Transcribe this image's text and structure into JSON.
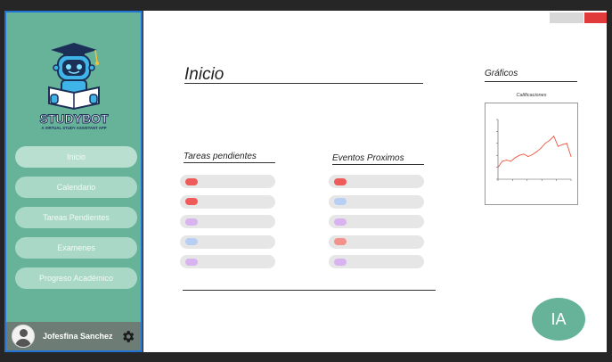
{
  "colors": {
    "sidebar": "#66b39a",
    "nav_button": "#a9d8c7",
    "accent_border": "#1f74d6",
    "red": "#ef5b5b",
    "purple": "#d9b3f0",
    "blue": "#b8cff5",
    "pink": "#f3928d"
  },
  "brand": {
    "name": "STUDYBOT",
    "tagline": "A VIRTUAL STUDY ASSISTANT APP",
    "logo_icon": "robot-graduation-cap-icon"
  },
  "sidebar": {
    "items": [
      {
        "label": "Inicio"
      },
      {
        "label": "Calendario"
      },
      {
        "label": "Tareas Pendientes"
      },
      {
        "label": "Examenes"
      },
      {
        "label": "Progreso Académico"
      }
    ]
  },
  "user": {
    "name": "Jofesfina Sanchez",
    "avatar_icon": "user-avatar-icon",
    "settings_icon": "gear-icon"
  },
  "main": {
    "title": "Inicio",
    "tasks": {
      "title": "Tareas pendientes",
      "items": [
        {
          "color": "#ef5b5b"
        },
        {
          "color": "#ef5b5b"
        },
        {
          "color": "#d9b3f0"
        },
        {
          "color": "#b8cff5"
        },
        {
          "color": "#d9b3f0"
        }
      ]
    },
    "events": {
      "title": "Eventos Proximos",
      "items": [
        {
          "color": "#ef5b5b"
        },
        {
          "color": "#b8cff5"
        },
        {
          "color": "#d9b3f0"
        },
        {
          "color": "#f3928d"
        },
        {
          "color": "#d9b3f0"
        }
      ]
    },
    "charts_title": "Gráficos",
    "ia_button": "IA"
  },
  "chart_data": {
    "type": "line",
    "title": "Calificaciones",
    "x": [
      1,
      2,
      3,
      4,
      5,
      6,
      7,
      8,
      9,
      10,
      11,
      12,
      13,
      14,
      15,
      16,
      17,
      18
    ],
    "values": [
      2,
      3,
      3.2,
      3,
      3.6,
      4,
      4.2,
      3.8,
      4.1,
      4.6,
      5.2,
      6,
      6.5,
      7.2,
      5.5,
      5.8,
      6,
      3.8
    ],
    "ylim": [
      0,
      10
    ],
    "grid": false,
    "line_color": "#e8553f"
  }
}
